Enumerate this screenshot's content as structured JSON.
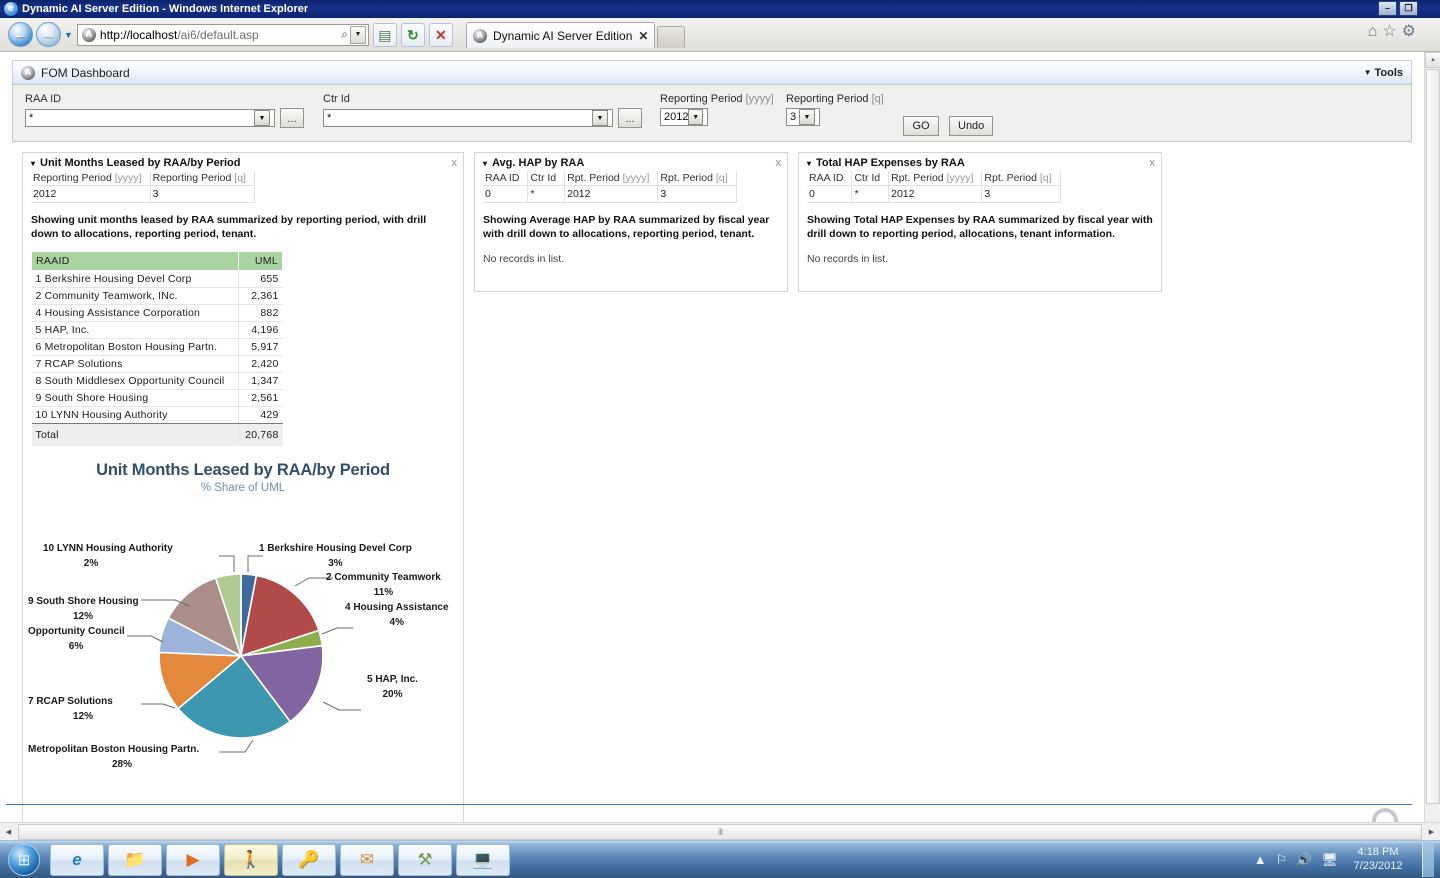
{
  "window": {
    "title": "Dynamic AI Server Edition - Windows Internet Explorer",
    "minimize_label": "–",
    "restore_label": "❐",
    "close_label": "✕"
  },
  "browser": {
    "back_icon": "←",
    "forward_icon": "→",
    "history_caret": "▼",
    "url_host": "http://localhost",
    "url_path": "/ai6/default.asp",
    "search_icon": "⌕",
    "address_dropdown_icon": "▼",
    "compatibility_icon": "▤",
    "refresh_icon": "↻",
    "stop_icon": "✕",
    "tab_title": "Dynamic AI Server Edition",
    "tab_close_icon": "✕",
    "new_tab_label": "",
    "home_icon": "⌂",
    "favorites_icon": "☆",
    "tools_icon": "⚙"
  },
  "app": {
    "logo_text": "A",
    "title": "FOM Dashboard",
    "tools_label": "Tools",
    "tools_caret": "▼"
  },
  "filters": {
    "raa_id": {
      "label": "RAA ID",
      "value": "*",
      "browse_label": "...",
      "dropdown_icon": "▼"
    },
    "ctr_id": {
      "label": "Ctr Id",
      "value": "*",
      "browse_label": "...",
      "dropdown_icon": "▼"
    },
    "period_year": {
      "label": "Reporting Period ",
      "unit": "[yyyy]",
      "value": "2012",
      "dropdown_icon": "▼"
    },
    "period_quarter": {
      "label": "Reporting Period ",
      "unit": "[q]",
      "value": "3",
      "dropdown_icon": "▼"
    },
    "go_label": "GO",
    "undo_label": "Undo"
  },
  "panels": {
    "uml": {
      "title": "Unit Months Leased by RAA/by Period",
      "collapse_icon": "▾",
      "close_icon": "x",
      "context_headers": [
        {
          "label": "Reporting Period ",
          "unit": "[yyyy]"
        },
        {
          "label": "Reporting Period ",
          "unit": "[q]"
        }
      ],
      "context_values": [
        "2012",
        "3"
      ],
      "description": "Showing unit months leased by RAA summarized by reporting period, with drill down to allocations, reporting period, tenant.",
      "grid": {
        "columns": [
          "RAAID",
          "UML"
        ],
        "rows": [
          [
            "1 Berkshire Housing Devel Corp",
            "655"
          ],
          [
            "2 Community Teamwork, INc.",
            "2,361"
          ],
          [
            "4 Housing Assistance Corporation",
            "882"
          ],
          [
            "5 HAP, Inc.",
            "4,196"
          ],
          [
            "6 Metropolitan Boston Housing Partn.",
            "5,917"
          ],
          [
            "7 RCAP Solutions",
            "2,420"
          ],
          [
            "8 South Middlesex Opportunity Council",
            "1,347"
          ],
          [
            "9 South Shore Housing",
            "2,561"
          ],
          [
            "10 LYNN Housing Authority",
            "429"
          ]
        ],
        "total_label": "Total",
        "total_value": "20,768"
      }
    },
    "avg_hap": {
      "title": "Avg. HAP by RAA",
      "collapse_icon": "▾",
      "close_icon": "x",
      "context_headers": [
        {
          "label": "RAA ID",
          "unit": ""
        },
        {
          "label": "Ctr Id",
          "unit": ""
        },
        {
          "label": "Rpt. Period ",
          "unit": "[yyyy]"
        },
        {
          "label": "Rpt. Period ",
          "unit": "[q]"
        }
      ],
      "context_values": [
        "0",
        "*",
        "2012",
        "3"
      ],
      "description": "Showing Average HAP by RAA summarized by fiscal year with drill down to allocations, reporting period, tenant.",
      "empty_text": "No records in list."
    },
    "total_hap": {
      "title": "Total HAP Expenses by RAA",
      "collapse_icon": "▾",
      "close_icon": "x",
      "context_headers": [
        {
          "label": "RAA ID",
          "unit": ""
        },
        {
          "label": "Ctr Id",
          "unit": ""
        },
        {
          "label": "Rpt. Period ",
          "unit": "[yyyy]"
        },
        {
          "label": "Rpt. Period ",
          "unit": "[q]"
        }
      ],
      "context_values": [
        "0",
        "*",
        "2012",
        "3"
      ],
      "description": "Showing Total HAP Expenses by RAA summarized by fiscal year with drill down to reporting period, allocations, tenant information.",
      "empty_text": "No records in list."
    }
  },
  "chart_data": {
    "type": "pie",
    "title": "Unit Months Leased by RAA/by Period",
    "subtitle": "% Share of UML",
    "xlabel": "",
    "ylabel": "",
    "legend_position": "callout-labels",
    "grid": false,
    "categories": [
      "1 Berkshire Housing Devel Corp",
      "2 Community Teamwork",
      "4 Housing Assistance",
      "5 HAP, Inc.",
      "6 Metropolitan Boston Housing Partn.",
      "7 RCAP Solutions",
      "8 South Middlesex Opportunity Council",
      "9 South Shore Housing",
      "10 LYNN Housing Authority"
    ],
    "values": [
      655,
      2361,
      882,
      4196,
      5917,
      2420,
      1347,
      2561,
      429
    ],
    "percents": [
      3,
      11,
      4,
      20,
      28,
      12,
      6,
      12,
      2
    ],
    "percent_labels": [
      "3%",
      "11%",
      "4%",
      "20%",
      "28%",
      "12%",
      "6%",
      "12%",
      "2%"
    ],
    "label_display": [
      "1 Berkshire Housing Devel Corp",
      "2 Community Teamwork",
      "4 Housing Assistance",
      "5 HAP, Inc.",
      "Metropolitan Boston Housing Partn.",
      "7 RCAP Solutions",
      "Opportunity Council",
      "9 South Shore Housing",
      "10 LYNN Housing Authority"
    ],
    "colors": [
      "#4a7ebb",
      "#b5484a",
      "#8fb košice",
      "#8064a2",
      "#4bacc6",
      "#e08a3c",
      "#a0b7da",
      "#a88b86",
      "#b2ce9a"
    ],
    "slice_colors": [
      "#40699c",
      "#b04b4a",
      "#8eae4e",
      "#8165a0",
      "#3d97ae",
      "#e3883d",
      "#9cb4da",
      "#ab8d89",
      "#b0cb92"
    ],
    "total_label": "Total",
    "total_value": 20768
  },
  "taskbar": {
    "start_icon": "⊞",
    "buttons": [
      {
        "name": "internet-explorer",
        "icon": "e"
      },
      {
        "name": "windows-explorer",
        "icon": "▤"
      },
      {
        "name": "media-player",
        "icon": "▶"
      },
      {
        "name": "dynamic-ai",
        "icon": "♟"
      },
      {
        "name": "password-tool",
        "icon": "⚿"
      },
      {
        "name": "outlook",
        "icon": "✉"
      },
      {
        "name": "database-tool",
        "icon": "⛏"
      },
      {
        "name": "remote-desktop",
        "icon": "❐"
      }
    ],
    "tray": {
      "expand_icon": "▲",
      "network_icon": "⚐",
      "volume_icon": "ᴘ",
      "action_icon": "☐",
      "time": "4:18 PM",
      "date": "7/23/2012"
    }
  },
  "scrollbars": {
    "up_icon": "▲",
    "down_icon": "▼",
    "left_icon": "◀",
    "right_icon": "▶",
    "grip": "III"
  }
}
